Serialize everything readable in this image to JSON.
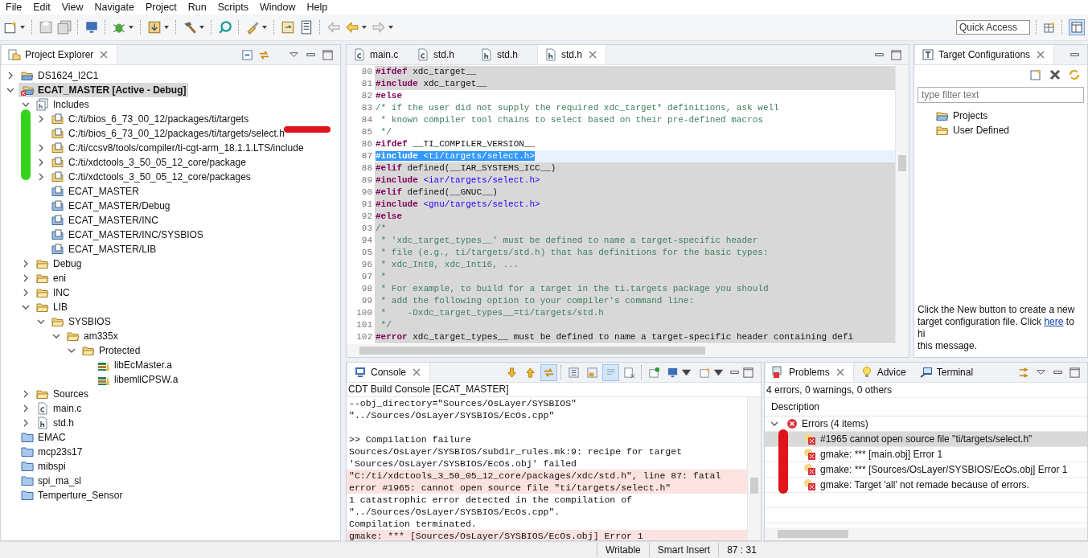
{
  "menu": [
    "File",
    "Edit",
    "View",
    "Navigate",
    "Project",
    "Run",
    "Scripts",
    "Window",
    "Help"
  ],
  "toolbar": {
    "quick_access": {
      "placeholder": "Quick Access"
    }
  },
  "project_explorer": {
    "title": "Project Explorer",
    "tree": [
      {
        "label": "DS1624_I2C1",
        "kind": "project",
        "selected": false,
        "expanded": false
      },
      {
        "label": "ECAT_MASTER  [Active - Debug]",
        "kind": "active-project",
        "selected": true,
        "expanded": true,
        "children": [
          {
            "label": "Includes",
            "kind": "includes",
            "selected": false,
            "expanded": true,
            "children": [
              {
                "label": "C:/ti/bios_6_73_00_12/packages/ti/targets",
                "kind": "include-path",
                "selected": false,
                "expanded": false
              },
              {
                "label": "C:/ti/bios_6_73_00_12/packages/ti/targets/select.h",
                "kind": "include-path",
                "selected": false
              },
              {
                "label": "C:/ti/ccsv8/tools/compiler/ti-cgt-arm_18.1.1.LTS/include",
                "kind": "include-path",
                "selected": false,
                "expanded": false
              },
              {
                "label": "C:/ti/xdctools_3_50_05_12_core/package",
                "kind": "include-path",
                "selected": false,
                "expanded": false
              },
              {
                "label": "C:/ti/xdctools_3_50_05_12_core/packages",
                "kind": "include-path",
                "selected": false,
                "expanded": false
              },
              {
                "label": "ECAT_MASTER",
                "kind": "include-project",
                "selected": false
              },
              {
                "label": "ECAT_MASTER/Debug",
                "kind": "include-project",
                "selected": false
              },
              {
                "label": "ECAT_MASTER/INC",
                "kind": "include-project",
                "selected": false
              },
              {
                "label": "ECAT_MASTER/INC/SYSBIOS",
                "kind": "include-project",
                "selected": false
              },
              {
                "label": "ECAT_MASTER/LIB",
                "kind": "include-project",
                "selected": false
              }
            ]
          },
          {
            "label": "Debug",
            "kind": "folder",
            "selected": false,
            "expanded": false
          },
          {
            "label": "eni",
            "kind": "folder",
            "selected": false,
            "expanded": false
          },
          {
            "label": "INC",
            "kind": "folder",
            "selected": false,
            "expanded": false
          },
          {
            "label": "LIB",
            "kind": "folder",
            "selected": false,
            "expanded": true,
            "children": [
              {
                "label": "SYSBIOS",
                "kind": "folder",
                "selected": false,
                "expanded": true,
                "children": [
                  {
                    "label": "am335x",
                    "kind": "folder",
                    "selected": false,
                    "expanded": true,
                    "children": [
                      {
                        "label": "Protected",
                        "kind": "folder",
                        "selected": false,
                        "expanded": true,
                        "children": [
                          {
                            "label": "libEcMaster.a",
                            "kind": "library",
                            "selected": false
                          },
                          {
                            "label": "libemllCPSW.a",
                            "kind": "library",
                            "selected": false
                          }
                        ]
                      }
                    ]
                  }
                ]
              }
            ]
          },
          {
            "label": "Sources",
            "kind": "folder",
            "selected": false,
            "expanded": false
          },
          {
            "label": "main.c",
            "kind": "c-file",
            "selected": false,
            "expanded": false
          },
          {
            "label": "std.h",
            "kind": "h-file",
            "selected": false,
            "expanded": false
          }
        ]
      },
      {
        "label": "EMAC",
        "kind": "closed-project",
        "selected": false
      },
      {
        "label": "mcp23s17",
        "kind": "closed-project",
        "selected": false
      },
      {
        "label": "mibspi",
        "kind": "closed-project",
        "selected": false
      },
      {
        "label": "spi_ma_sl",
        "kind": "closed-project",
        "selected": false
      },
      {
        "label": "Temperture_Sensor",
        "kind": "closed-project",
        "selected": false
      }
    ]
  },
  "editor": {
    "tabs": [
      {
        "label": "main.c",
        "kind": "c-file",
        "selected": false
      },
      {
        "label": "std.h",
        "kind": "c-file",
        "selected": false
      },
      {
        "label": "std.h",
        "kind": "h-file",
        "selected": false
      },
      {
        "label": "std.h",
        "kind": "h-file",
        "selected": true
      }
    ],
    "lines": [
      {
        "number": "80",
        "inactive": true,
        "selected": false,
        "tokens": [
          {
            "kind": "directive",
            "text": "#ifdef"
          },
          {
            "kind": "plain",
            "text": " xdc_target__"
          }
        ]
      },
      {
        "number": "81",
        "inactive": true,
        "selected": false,
        "tokens": [
          {
            "kind": "directive",
            "text": "#include"
          },
          {
            "kind": "plain",
            "text": " xdc_target__"
          }
        ]
      },
      {
        "number": "82",
        "inactive": false,
        "selected": false,
        "tokens": [
          {
            "kind": "directive",
            "text": "#else"
          }
        ]
      },
      {
        "number": "83",
        "inactive": false,
        "selected": false,
        "tokens": [
          {
            "kind": "comment",
            "text": "/* if the user did not supply the required xdc_target* definitions, ask well"
          }
        ]
      },
      {
        "number": "84",
        "inactive": false,
        "selected": false,
        "tokens": [
          {
            "kind": "comment",
            "text": " * known compiler tool chains to select based on their pre-defined macros"
          }
        ]
      },
      {
        "number": "85",
        "inactive": false,
        "selected": false,
        "tokens": [
          {
            "kind": "comment",
            "text": " */"
          }
        ]
      },
      {
        "number": "86",
        "inactive": false,
        "selected": false,
        "tokens": [
          {
            "kind": "directive",
            "text": "#ifdef"
          },
          {
            "kind": "plain",
            "text": " __TI_COMPILER_VERSION__"
          }
        ]
      },
      {
        "number": "87",
        "inactive": false,
        "selected": true,
        "tokens": [
          {
            "kind": "directive",
            "text": "#include"
          },
          {
            "kind": "string",
            "text": " <ti/targets/select.h>"
          }
        ]
      },
      {
        "number": "88",
        "inactive": true,
        "selected": false,
        "tokens": [
          {
            "kind": "directive",
            "text": "#elif"
          },
          {
            "kind": "plain",
            "text": " defined(__IAR_SYSTEMS_ICC__)"
          }
        ]
      },
      {
        "number": "89",
        "inactive": true,
        "selected": false,
        "tokens": [
          {
            "kind": "directive",
            "text": "#include"
          },
          {
            "kind": "string",
            "text": " <iar/targets/select.h>"
          }
        ]
      },
      {
        "number": "90",
        "inactive": true,
        "selected": false,
        "tokens": [
          {
            "kind": "directive",
            "text": "#elif"
          },
          {
            "kind": "plain",
            "text": " defined(__GNUC__)"
          }
        ]
      },
      {
        "number": "91",
        "inactive": true,
        "selected": false,
        "tokens": [
          {
            "kind": "directive",
            "text": "#include"
          },
          {
            "kind": "string",
            "text": " <gnu/targets/select.h>"
          }
        ]
      },
      {
        "number": "92",
        "inactive": true,
        "selected": false,
        "tokens": [
          {
            "kind": "directive",
            "text": "#else"
          }
        ]
      },
      {
        "number": "93",
        "inactive": true,
        "selected": false,
        "tokens": [
          {
            "kind": "comment",
            "text": "/*"
          }
        ]
      },
      {
        "number": "94",
        "inactive": true,
        "selected": false,
        "tokens": [
          {
            "kind": "comment",
            "text": " * 'xdc_target_types__' must be defined to name a target-specific header"
          }
        ]
      },
      {
        "number": "95",
        "inactive": true,
        "selected": false,
        "tokens": [
          {
            "kind": "comment",
            "text": " * file (e.g., ti/targets/std.h) that has definitions for the basic types:"
          }
        ]
      },
      {
        "number": "96",
        "inactive": true,
        "selected": false,
        "tokens": [
          {
            "kind": "comment",
            "text": " * xdc_Int8, xdc_Int16, ..."
          }
        ]
      },
      {
        "number": "97",
        "inactive": true,
        "selected": false,
        "tokens": [
          {
            "kind": "comment",
            "text": " *"
          }
        ]
      },
      {
        "number": "98",
        "inactive": true,
        "selected": false,
        "tokens": [
          {
            "kind": "comment",
            "text": " * For example, to build for a target in the ti.targets package you should"
          }
        ]
      },
      {
        "number": "99",
        "inactive": true,
        "selected": false,
        "tokens": [
          {
            "kind": "comment",
            "text": " * add the following option to your compiler's command line:"
          }
        ]
      },
      {
        "number": "100",
        "inactive": true,
        "selected": false,
        "tokens": [
          {
            "kind": "comment",
            "text": " *    -Dxdc_target_types__=ti/targets/std.h"
          }
        ]
      },
      {
        "number": "101",
        "inactive": true,
        "selected": false,
        "tokens": [
          {
            "kind": "comment",
            "text": " */"
          }
        ]
      },
      {
        "number": "102",
        "inactive": true,
        "selected": false,
        "tokens": [
          {
            "kind": "directive",
            "text": "#error"
          },
          {
            "kind": "plain",
            "text": " xdc_target_types__ must be defined to name a target-specific header containing defi"
          }
        ]
      }
    ]
  },
  "target_configurations": {
    "title": "Target Configurations",
    "filter": {
      "placeholder": "type filter text"
    },
    "items": [
      {
        "label": "Projects",
        "kind": "project-folder",
        "selected": false
      },
      {
        "label": "User Defined",
        "kind": "folder",
        "selected": false
      }
    ],
    "message": {
      "before": "Click the New button to create a new target configuration file. Click",
      "link": "here",
      "after": "to hi",
      "last_line": "this message."
    }
  },
  "console": {
    "tab": {
      "label": "Console",
      "selected": true
    },
    "tools": [
      {
        "kind": "down-arrow",
        "pressed": false
      },
      {
        "kind": "up-arrow",
        "pressed": false
      },
      {
        "kind": "link",
        "pressed": true
      },
      {
        "kind": "doc-grid",
        "pressed": false
      },
      {
        "kind": "doc-lock",
        "pressed": false
      },
      {
        "kind": "wrap",
        "pressed": true
      },
      {
        "kind": "doc-remove",
        "pressed": false
      },
      {
        "kind": "pin",
        "pressed": false
      },
      {
        "kind": "display",
        "pressed": false
      },
      {
        "kind": "new-console",
        "pressed": false
      }
    ],
    "subtitle": "CDT Build Console [ECAT_MASTER]",
    "lines": [
      {
        "kind": "normal",
        "text": "--obj_directory=\"Sources/OsLayer/SYSBIOS\""
      },
      {
        "kind": "normal",
        "text": "\"../Sources/OsLayer/SYSBIOS/EcOs.cpp\""
      },
      {
        "kind": "blank"
      },
      {
        "kind": "normal",
        "text": ">> Compilation failure"
      },
      {
        "kind": "normal",
        "text": "Sources/OsLayer/SYSBIOS/subdir_rules.mk:9: recipe for target"
      },
      {
        "kind": "normal",
        "text": "'Sources/OsLayer/SYSBIOS/EcOs.obj' failed"
      },
      {
        "kind": "error",
        "text": "\"C:/ti/xdctools_3_50_05_12_core/packages/xdc/std.h\", line 87: fatal"
      },
      {
        "kind": "error",
        "text": "error #1965: cannot open source file \"ti/targets/select.h\""
      },
      {
        "kind": "normal",
        "text": "1 catastrophic error detected in the compilation of"
      },
      {
        "kind": "normal",
        "text": "\"../Sources/OsLayer/SYSBIOS/EcOs.cpp\"."
      },
      {
        "kind": "normal",
        "text": "Compilation terminated."
      },
      {
        "kind": "error",
        "text": "gmake: *** [Sources/OsLayer/SYSBIOS/EcOs.obj] Error 1"
      }
    ]
  },
  "problems_panel": {
    "tabs": [
      {
        "label": "Problems",
        "kind": "problems",
        "selected": true
      },
      {
        "label": "Advice",
        "kind": "advice",
        "selected": false
      },
      {
        "label": "Terminal",
        "kind": "terminal",
        "selected": false
      }
    ],
    "summary": "4 errors, 0 warnings, 0 others",
    "column": "Description",
    "group": {
      "label": "Errors (4 items)",
      "expanded": true,
      "items": [
        {
          "text": "#1965 cannot open source file \"ti/targets/select.h\"",
          "selected": true
        },
        {
          "text": "gmake: *** [main.obj] Error 1",
          "selected": false
        },
        {
          "text": "gmake: *** [Sources/OsLayer/SYSBIOS/EcOs.obj] Error 1",
          "selected": false
        },
        {
          "text": "gmake: Target 'all' not remade because of errors.",
          "selected": false
        }
      ]
    }
  },
  "status_bar": {
    "mode": "Writable",
    "insert": "Smart Insert",
    "position": "87 : 31"
  }
}
